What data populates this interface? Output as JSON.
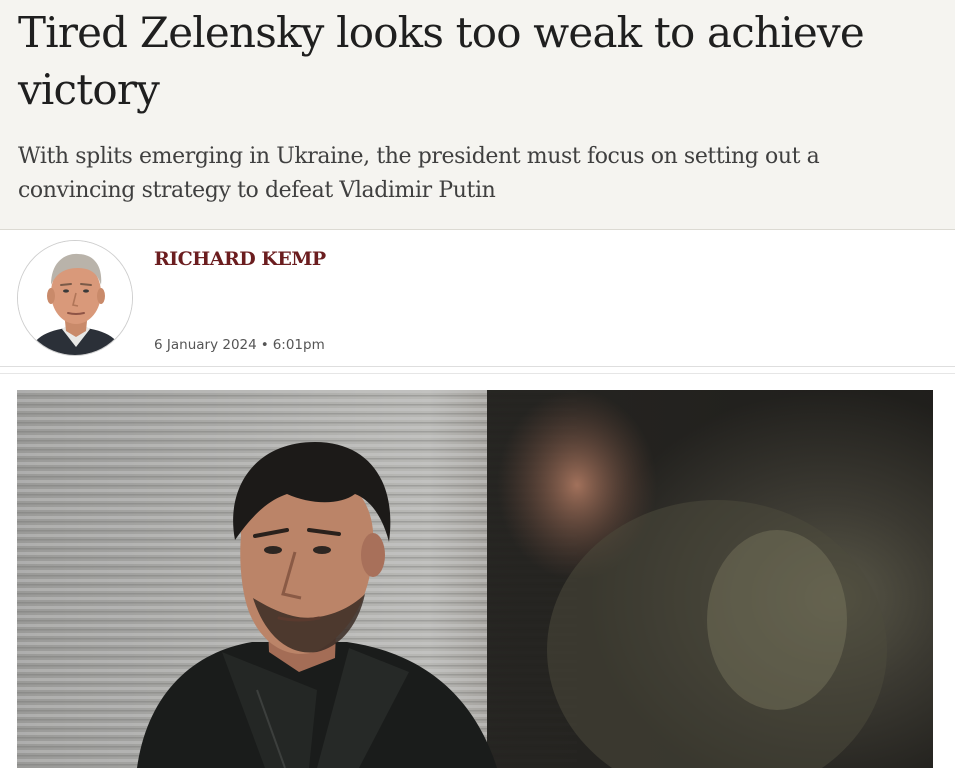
{
  "article": {
    "headline": "Tired Zelensky looks too weak to achieve victory",
    "standfirst": "With splits emerging in Ukraine, the president must focus on setting out a convincing strategy to defeat Vladimir Putin"
  },
  "byline": {
    "author": "RICHARD KEMP",
    "date": "6 January 2024",
    "separator": "•",
    "time": "6:01pm",
    "avatar_icon": "author-portrait"
  },
  "lead_image": {
    "icon": "lead-photo"
  },
  "colors": {
    "headline_background": "#f5f4f0",
    "author_name": "#6b1d1f",
    "headline_text": "#1f1f1f",
    "standfirst_text": "#3f3f3f",
    "meta_text": "#555555"
  }
}
